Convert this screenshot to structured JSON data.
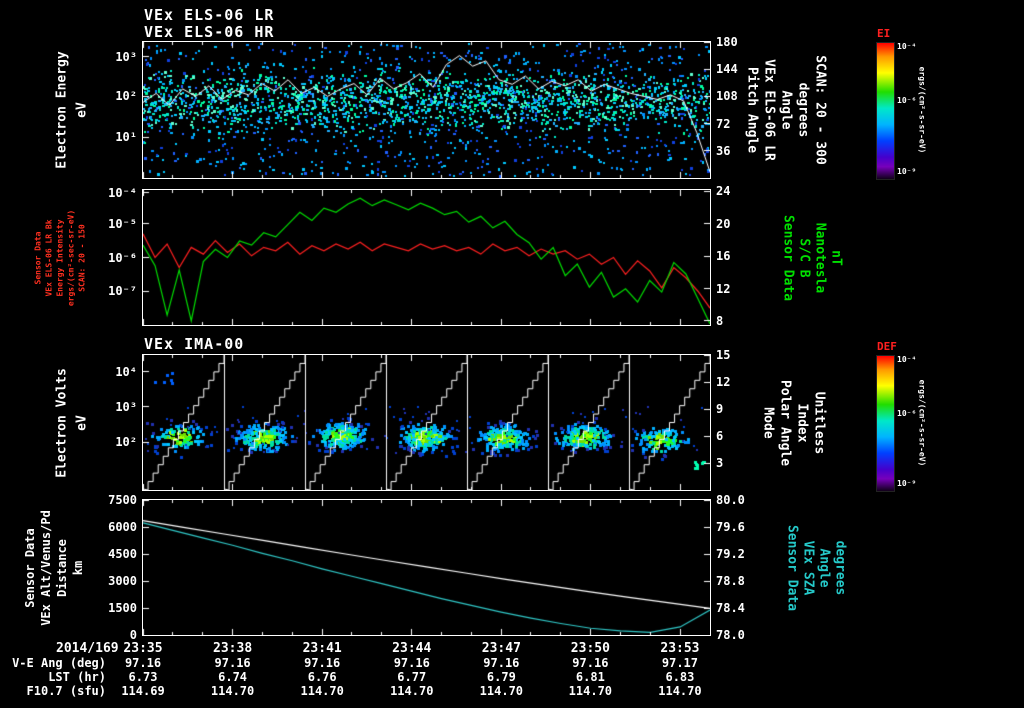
{
  "header": {
    "line1": "VEx ELS-06 LR",
    "line2": "VEx ELS-06 HR"
  },
  "date_label": "2014/169",
  "time_ticks": {
    "labels": [
      "23:35",
      "23:38",
      "23:41",
      "23:44",
      "23:47",
      "23:50",
      "23:53"
    ],
    "fracs": [
      0,
      0.158,
      0.316,
      0.474,
      0.632,
      0.789,
      0.947
    ],
    "minutes_span": 19
  },
  "bottom_rows": [
    {
      "label": "V-E Ang (deg)",
      "values": [
        "97.16",
        "97.16",
        "97.16",
        "97.16",
        "97.16",
        "97.16",
        "97.17"
      ]
    },
    {
      "label": "LST (hr)",
      "values": [
        "6.73",
        "6.74",
        "6.76",
        "6.77",
        "6.79",
        "6.81",
        "6.83"
      ]
    },
    {
      "label": "F10.7 (sfu)",
      "values": [
        "114.69",
        "114.70",
        "114.70",
        "114.70",
        "114.70",
        "114.70",
        "114.70"
      ]
    }
  ],
  "colorbars": [
    {
      "title": "EI",
      "title_color": "#ff2020",
      "units": "ergs/(cm²-s-sr-eV)",
      "ticks": [
        {
          "label": "10⁻⁴",
          "frac": 0.03
        },
        {
          "label": "10⁻⁶",
          "frac": 0.43
        },
        {
          "label": "10⁻⁹",
          "frac": 0.95
        }
      ],
      "gradient_stops": [
        "#ff0000 0%",
        "#ff9800 10%",
        "#ffff00 22%",
        "#20dd00 36%",
        "#00e8c8 48%",
        "#00b4ff 60%",
        "#0040ff 72%",
        "#4400cc 84%",
        "#7700bb 91%",
        "#11001a 100%"
      ]
    },
    {
      "title": "DEF",
      "title_color": "#ff2020",
      "units": "ergs/(cm²-s-sr-eV)",
      "ticks": [
        {
          "label": "10⁻⁴",
          "frac": 0.03
        },
        {
          "label": "10⁻⁶",
          "frac": 0.43
        },
        {
          "label": "10⁻⁹",
          "frac": 0.95
        }
      ],
      "gradient_stops": [
        "#ff0000 0%",
        "#ff9800 10%",
        "#ffff00 22%",
        "#20dd00 36%",
        "#00e8c8 48%",
        "#00b4ff 60%",
        "#0040ff 72%",
        "#4400cc 84%",
        "#7700bb 91%",
        "#11001a 100%"
      ]
    }
  ],
  "chart_data": [
    {
      "type": "heatmap",
      "title": "VEx ELS-06 LR / VEx ELS-06 HR",
      "x_range": [
        "23:35",
        "23:54"
      ],
      "left_label_lines": [
        "Electron Energy",
        "eV"
      ],
      "left_label_color": "#ffffff",
      "y_axis": {
        "scale": "log",
        "unit": "eV",
        "ticks": [
          {
            "label": "10³",
            "frac": 0.11
          },
          {
            "label": "10²",
            "frac": 0.4
          },
          {
            "label": "10¹",
            "frac": 0.7
          }
        ]
      },
      "right_axis": {
        "range": [
          180,
          0
        ],
        "ticks": [
          {
            "label": "180",
            "frac": 0.0
          },
          {
            "label": "144",
            "frac": 0.2
          },
          {
            "label": "108",
            "frac": 0.4
          },
          {
            "label": "72",
            "frac": 0.6
          },
          {
            "label": "36",
            "frac": 0.8
          }
        ]
      },
      "right_label_lines": [
        "Pitch Angle",
        "VEx ELS-06 LR",
        "Angle",
        "degrees",
        "SCAN: 20 - 300"
      ],
      "right_label_color": "#ffffff",
      "heatmap": {
        "seed": 7,
        "n_points": 2600,
        "band_prob": 0.62,
        "band_center_frac": 0.44,
        "band_sigma_frac": 0.1,
        "palette_band": [
          "#00e8c8",
          "#00d0ff",
          "#20b0ff",
          "#00ffa0",
          "#60ffd0"
        ],
        "palette_scatter": [
          "#0090ff",
          "#00b0ff",
          "#2060ff",
          "#00c8ff",
          "#1040e0"
        ]
      },
      "overlay": {
        "name": "Pitch Angle",
        "color": "#ffffff",
        "range": [
          180,
          0
        ],
        "values": [
          100,
          112,
          96,
          118,
          108,
          122,
          104,
          116,
          110,
          125,
          115,
          130,
          112,
          120,
          108,
          118,
          125,
          110,
          132,
          118,
          126,
          138,
          120,
          150,
          162,
          148,
          155,
          130,
          124,
          135,
          118,
          128,
          122,
          130,
          115,
          124,
          118,
          112,
          108,
          104,
          110,
          102,
          60,
          8
        ]
      }
    },
    {
      "type": "line",
      "title": "ELS Background Intensity and S/C B",
      "left_label_lines": [
        "Sensor Data",
        "VEx ELS-06 LR Bk",
        "Energy Intensity",
        "ergs/(cm²-sec-sr-eV)",
        "SCAN: 20 - 150"
      ],
      "left_label_color": "#ff3020",
      "left_axis": {
        "scale": "log",
        "range": [
          -4,
          -8
        ],
        "ticks": [
          {
            "label": "10⁻⁴",
            "frac": 0.02
          },
          {
            "label": "10⁻⁵",
            "frac": 0.25
          },
          {
            "label": "10⁻⁶",
            "frac": 0.5
          },
          {
            "label": "10⁻⁷",
            "frac": 0.75
          }
        ]
      },
      "right_axis": {
        "range": [
          24.2,
          7.8
        ],
        "ticks": [
          {
            "label": "24",
            "frac": 0.01
          },
          {
            "label": "20",
            "frac": 0.25
          },
          {
            "label": "16",
            "frac": 0.49
          },
          {
            "label": "12",
            "frac": 0.73
          },
          {
            "label": "8",
            "frac": 0.97
          }
        ]
      },
      "right_label_lines": [
        "Sensor Data",
        "S/C B",
        "Nanotesla",
        "nT"
      ],
      "right_label_color": "#00e000",
      "series": [
        {
          "name": "VEx ELS-06 LR Bk Energy Intensity",
          "color": "#ff2020",
          "axis": "left",
          "value_space": "log10(ergs/(cm²-sec-sr-eV))",
          "values": [
            -5.3,
            -6.0,
            -5.6,
            -6.3,
            -5.7,
            -5.9,
            -5.5,
            -5.85,
            -5.6,
            -5.95,
            -5.7,
            -5.8,
            -5.55,
            -5.9,
            -5.65,
            -5.8,
            -5.6,
            -5.75,
            -5.55,
            -5.8,
            -5.6,
            -5.7,
            -5.8,
            -5.6,
            -5.75,
            -5.65,
            -5.8,
            -5.7,
            -5.9,
            -5.6,
            -5.8,
            -5.7,
            -5.95,
            -5.75,
            -5.9,
            -5.8,
            -6.05,
            -5.9,
            -6.2,
            -6.0,
            -6.5,
            -6.1,
            -6.4,
            -6.9,
            -6.3,
            -6.6,
            -7.0,
            -7.5
          ]
        },
        {
          "name": "S/C B Nanotesla",
          "color": "#00dd00",
          "axis": "right",
          "value_space": "nT",
          "values": [
            17.5,
            15.0,
            9.0,
            14.5,
            8.3,
            15.5,
            17.0,
            16.0,
            18.0,
            17.5,
            19.0,
            18.5,
            20.0,
            21.5,
            20.5,
            22.0,
            21.5,
            22.5,
            23.2,
            22.3,
            23.0,
            22.4,
            21.8,
            22.6,
            22.0,
            21.2,
            21.6,
            20.3,
            21.0,
            19.6,
            20.4,
            18.8,
            17.8,
            15.8,
            17.2,
            13.8,
            15.2,
            12.4,
            14.2,
            11.2,
            12.2,
            10.6,
            13.2,
            11.8,
            15.4,
            14.0,
            11.0,
            7.6
          ]
        }
      ]
    },
    {
      "type": "heatmap",
      "title": "VEx IMA-00",
      "left_label_lines": [
        "Electron Volts",
        "eV"
      ],
      "left_label_color": "#ffffff",
      "y_axis": {
        "scale": "log",
        "unit": "eV",
        "ticks": [
          {
            "label": "10⁴",
            "frac": 0.125
          },
          {
            "label": "10³",
            "frac": 0.385
          },
          {
            "label": "10²",
            "frac": 0.645
          }
        ]
      },
      "right_axis": {
        "range": [
          15,
          0
        ],
        "ticks": [
          {
            "label": "15",
            "frac": 0.0
          },
          {
            "label": "12",
            "frac": 0.2
          },
          {
            "label": "9",
            "frac": 0.4
          },
          {
            "label": "6",
            "frac": 0.6
          },
          {
            "label": "3",
            "frac": 0.8
          }
        ]
      },
      "right_label_lines": [
        "Mode",
        "Polar Angle",
        "Index",
        "Unitless"
      ],
      "right_label_color": "#ffffff",
      "heatmap": {
        "seed": 13,
        "segments": 7,
        "band_center_frac": 0.61,
        "segment_scales": [
          0.5,
          1.0,
          1.0,
          1.05,
          0.9,
          0.85,
          0.55
        ],
        "palette_core": [
          "#20ff20",
          "#70e000",
          "#a8ff00"
        ],
        "palette_mid": [
          "#00e0a0",
          "#00c8ff"
        ],
        "palette_edge": [
          "#0090ff",
          "#00b0ff"
        ],
        "palette_faint": [
          "#0040d0",
          "#2030b0"
        ]
      },
      "sawtooth": {
        "name": "Polar Angle Index",
        "color": "#ffffff",
        "cycles": 7,
        "steps": 16,
        "range": [
          0,
          15
        ]
      }
    },
    {
      "type": "line",
      "title": "VEx Altitude and Solar Zenith Angle",
      "left_label_lines": [
        "Sensor Data",
        "VEx Alt/Venus/Pd",
        "Distance",
        "km"
      ],
      "left_label_color": "#ffffff",
      "left_axis": {
        "range": [
          7500,
          0
        ],
        "ticks": [
          {
            "label": "7500",
            "frac": 0.0
          },
          {
            "label": "6000",
            "frac": 0.2
          },
          {
            "label": "4500",
            "frac": 0.4
          },
          {
            "label": "3000",
            "frac": 0.6
          },
          {
            "label": "1500",
            "frac": 0.8
          },
          {
            "label": "0",
            "frac": 1.0
          }
        ]
      },
      "right_axis": {
        "range": [
          80.0,
          78.0
        ],
        "ticks": [
          {
            "label": "80.0",
            "frac": 0.0
          },
          {
            "label": "79.6",
            "frac": 0.2
          },
          {
            "label": "79.2",
            "frac": 0.4
          },
          {
            "label": "78.8",
            "frac": 0.6
          },
          {
            "label": "78.4",
            "frac": 0.8
          },
          {
            "label": "78.0",
            "frac": 1.0
          }
        ]
      },
      "right_label_lines": [
        "Sensor Data",
        "VEx SZA",
        "Angle",
        "degrees"
      ],
      "right_label_color": "#25c8c8",
      "series": [
        {
          "name": "VEx Alt/Venus/Pd Distance km",
          "color": "#ffffff",
          "axis": "left",
          "values": [
            6350,
            5980,
            5610,
            5240,
            4870,
            4500,
            4140,
            3780,
            3430,
            3080,
            2740,
            2410,
            2090,
            1780,
            1480
          ]
        },
        {
          "name": "VEx SZA degrees",
          "color": "#30c8c8",
          "axis": "right",
          "values": [
            79.66,
            79.55,
            79.44,
            79.33,
            79.21,
            79.1,
            78.98,
            78.87,
            78.76,
            78.65,
            78.54,
            78.44,
            78.34,
            78.25,
            78.17,
            78.1,
            78.06,
            78.04,
            78.12,
            78.37
          ]
        }
      ]
    }
  ]
}
